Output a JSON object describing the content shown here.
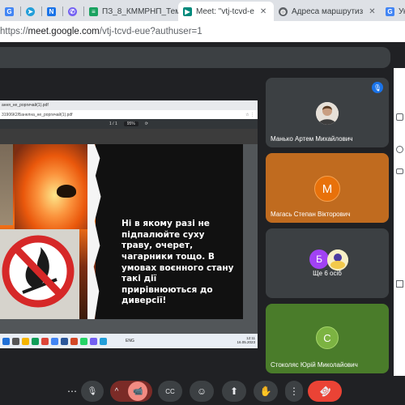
{
  "browser": {
    "tabs": [
      {
        "label": "",
        "icon": "google-icon",
        "color": "#4285f4"
      },
      {
        "label": "",
        "icon": "telegram-icon",
        "color": "#229ed9"
      },
      {
        "label": "",
        "icon": "n-icon",
        "color": "#1a73e8"
      },
      {
        "label": "",
        "icon": "viber-icon",
        "color": "#7360f2"
      },
      {
        "label": "ПЗ_8_КММРНП_Тем",
        "icon": "doc-icon",
        "color": "#1aa260"
      },
      {
        "label": "Meet: \"vtj-tcvd-e",
        "icon": "meet-icon",
        "color": "#00897b"
      },
      {
        "label": "Адреса маршрутиз",
        "icon": "globe-icon",
        "color": "#5f6368"
      },
      {
        "label": "Ук",
        "icon": "g-icon",
        "color": "#4285f4"
      }
    ],
    "url_prefix": "https://",
    "url_host": "meet.google.com",
    "url_path": "/vtj-tcvd-eue?authuser=1"
  },
  "presentation": {
    "pdf_tab": "ання_не_роргичай(1).pdf",
    "pdf_path": "31906К2/Банелна_не_роргичай(1).pdf",
    "zoom": "95%",
    "page": "1 / 1",
    "slide_text": "Ні в якому разі не підпалюйте суху траву, очерет, чагарники тощо. В умовах воєнного стану такі дії прирівнюються до диверсії!",
    "lang": "ENG",
    "clock_time": "12:11",
    "clock_date": "16.05.2023"
  },
  "participants": [
    {
      "name": "Манько Артем Михайлович",
      "avatar_letter": "",
      "tile_color": "#3c4043",
      "avatar_color": "#e8eaed",
      "muted": true
    },
    {
      "name": "Магась Степан Вікторович",
      "avatar_letter": "М",
      "tile_color": "#c06b1f",
      "avatar_color": "#e8710a"
    },
    {
      "name": "Ще 6 осіб",
      "avatar_letter": "Б",
      "tile_color": "#3c4043",
      "avatar_color": "#a142f4"
    },
    {
      "name": "Стоколяс Юрій Миколайович",
      "avatar_letter": "С",
      "tile_color": "#4a7c2a",
      "avatar_color": "#7cb342"
    }
  ],
  "controls": {
    "more_label": "⋯",
    "mic_label": "🎙",
    "chevron_label": "^",
    "cam_label": "📹",
    "captions_label": "CC",
    "emoji_label": "☺",
    "present_label": "⬆",
    "hand_label": "✋",
    "options_label": "⋮",
    "end_label": "☎"
  }
}
